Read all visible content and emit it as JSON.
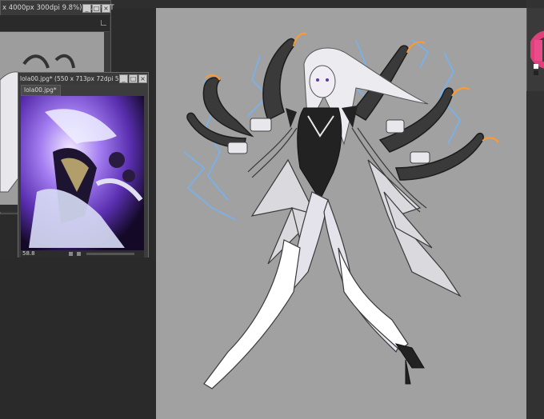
{
  "back_window": {
    "title": "x 4000px 300dpi 9.8%) - CLIP ST",
    "buttons": [
      "_",
      "□",
      "×"
    ],
    "status": ""
  },
  "ref_window": {
    "title": "lola00.jpg* (550 x 713px 72dpi 58.8%)",
    "tab_label": "lola00.jpg*",
    "zoom": "58.8",
    "buttons": [
      "_",
      "□",
      "×"
    ]
  },
  "icons": {
    "minimize": "minimize-icon",
    "maximize": "maximize-icon",
    "close": "close-icon",
    "color_wheel": "color-wheel-icon"
  },
  "colors": {
    "canvas_bg": "#a1a1a1",
    "app_bg": "#2b2b2b",
    "panel": "#3b3b3b",
    "accent_magenta": "#e0407a",
    "lightning": "#6db6ff"
  }
}
